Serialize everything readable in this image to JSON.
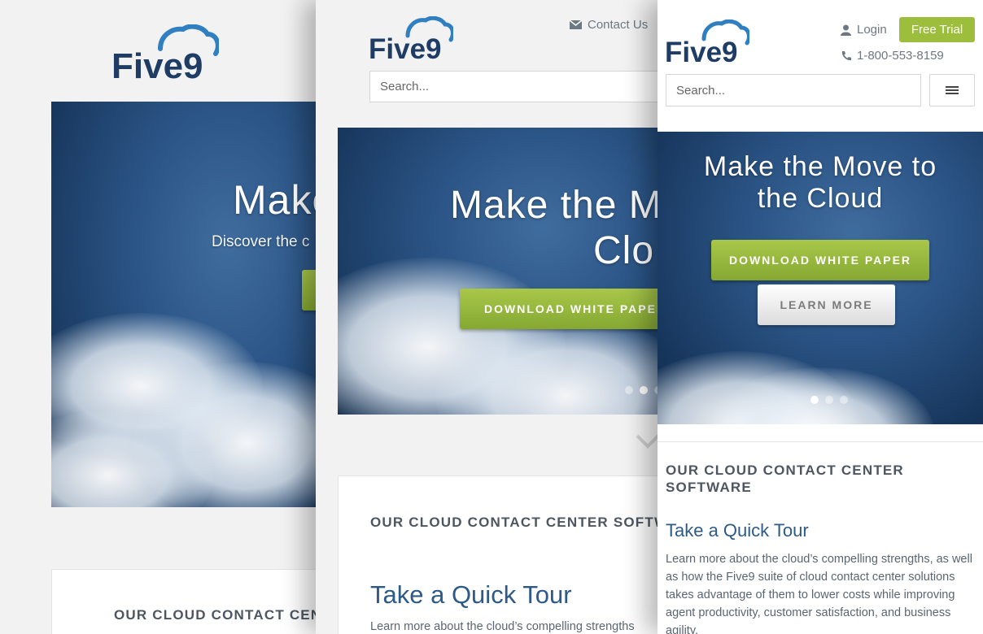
{
  "brand": {
    "logo_text": "Five9",
    "logo_color": "#1f3c64",
    "cloud_color": "#2f7fc1"
  },
  "nav": {
    "contact_label": "Contact Us",
    "login_label": "Login",
    "trial_label": "Free Trial",
    "phone": "1-800-553-8159"
  },
  "search": {
    "placeholder": "Search..."
  },
  "hero": {
    "title_short": "Make",
    "title_mid_line1": "Make the M",
    "title_mid_line2": "Clo",
    "title_line1": "Make the Move to",
    "title_line2": "the Cloud",
    "subtitle_short": "Discover the c",
    "download_label": "DOWNLOAD WHITE PAPER",
    "download_label_cropped": "DOWNLOAD WHITE PAPER",
    "learn_label": "LEARN MORE"
  },
  "section": {
    "title_cropped_p1": "OUR CLOUD CONTACT CEN",
    "title_cropped_p2": "OUR CLOUD CONTACT CENTER SOFTW",
    "title_line1": "OUR CLOUD CONTACT CENTER",
    "title_line2": "SOFTWARE",
    "tour_title": "Take a Quick Tour",
    "tour_text": "Learn more about the cloud’s compelling strengths, as well as how the Five9 suite of cloud contact center solutions takes advantage of them to lower costs while improving agent productivity, customer satisfaction, and business agility.",
    "tour_text_cropped": "Learn more about the cloud’s compelling strengths"
  },
  "colors": {
    "green": "#9dbd3c",
    "accent_blue": "#2d5a86",
    "text": "#4d5661"
  }
}
